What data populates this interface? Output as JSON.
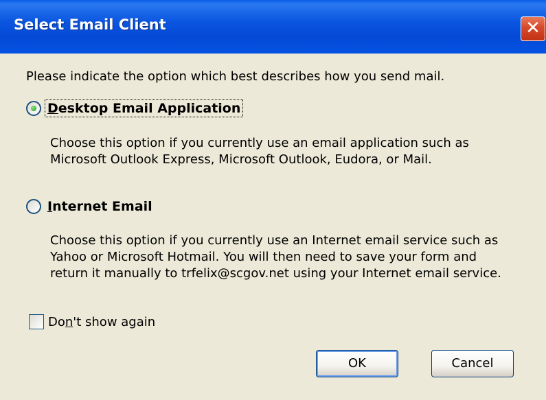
{
  "window": {
    "title": "Select Email Client",
    "close_glyph": "✕"
  },
  "dialog": {
    "prompt": "Please indicate the option which best describes how you send mail.",
    "options": [
      {
        "label_first": "D",
        "label_rest": "esktop Email Application",
        "selected": true,
        "description": [
          "Choose this option if you currently use an email application such as",
          "Microsoft Outlook Express, Microsoft Outlook, Eudora, or Mail."
        ]
      },
      {
        "label_first": "I",
        "label_rest": "nternet Email",
        "selected": false,
        "description": [
          "Choose this option if you currently use an Internet email service such as",
          "Yahoo or Microsoft Hotmail. You will then need to save your form and",
          "return it manually to trfelix@scgov.net using your Internet email service."
        ]
      }
    ],
    "dont_show": {
      "label_pre": "Do",
      "label_key": "n",
      "label_post": "'t show again",
      "checked": false
    },
    "buttons": {
      "ok": "OK",
      "cancel": "Cancel"
    }
  },
  "colors": {
    "titlebar": "#0349d6",
    "close": "#c23214",
    "face": "#ece9d8"
  }
}
